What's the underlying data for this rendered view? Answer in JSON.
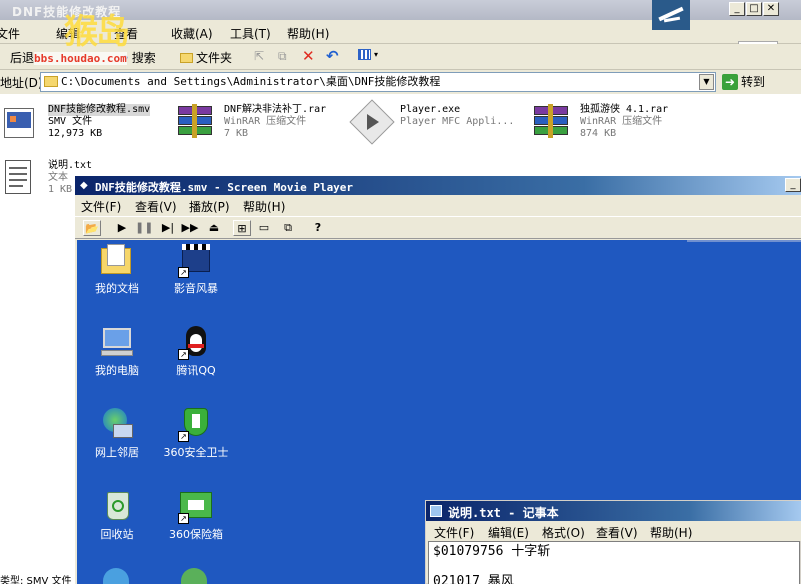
{
  "explorer": {
    "title": "DNF技能修改教程",
    "menu": [
      "文件",
      "编辑",
      "查看",
      "收藏(A)",
      "工具(T)",
      "帮助(H)"
    ],
    "toolbar": {
      "back": "后退",
      "search": "搜索",
      "folders": "文件夹"
    },
    "address": {
      "label": "地址(D)",
      "path": "C:\\Documents and Settings\\Administrator\\桌面\\DNF技能修改教程",
      "go": "转到"
    },
    "files": [
      {
        "name": "DNF技能修改教程.smv",
        "line2": "SMV 文件",
        "line3": "12,973 KB"
      },
      {
        "name": "DNF解决非法补丁.rar",
        "line2": "WinRAR 压缩文件",
        "line3": "7 KB"
      },
      {
        "name": "Player.exe",
        "line2": "Player MFC Appli..."
      },
      {
        "name": "独孤游侠 4.1.rar",
        "line2": "WinRAR 压缩文件",
        "line3": "874 KB"
      },
      {
        "name": "说明.txt",
        "line2": "文本",
        "line3": "1 KB"
      }
    ],
    "status_text": "类型: SMV 文件"
  },
  "watermark": {
    "url": "bbs.houdao.com",
    "logo_text": "猴岛"
  },
  "player": {
    "title": "DNF技能修改教程.smv - Screen Movie Player",
    "menu": [
      "文件(F)",
      "查看(V)",
      "播放(P)",
      "帮助(H)"
    ],
    "desktop_icons": [
      {
        "label": "我的文档",
        "icon": "my-documents-icon"
      },
      {
        "label": "影音风暴",
        "icon": "media-player-icon"
      },
      {
        "label": "我的电脑",
        "icon": "my-computer-icon"
      },
      {
        "label": "腾讯QQ",
        "icon": "qq-penguin-icon"
      },
      {
        "label": "网上邻居",
        "icon": "network-places-icon"
      },
      {
        "label": "360安全卫士",
        "icon": "360-safe-icon"
      },
      {
        "label": "回收站",
        "icon": "recycle-bin-icon"
      },
      {
        "label": "360保险箱",
        "icon": "360-safebox-icon"
      }
    ],
    "colors": {
      "desktop_bg": "#1f58c0",
      "title_bar": "#0a246a"
    }
  },
  "notepad": {
    "title": "说明.txt - 记事本",
    "menu": [
      "文件(F)",
      "编辑(E)",
      "格式(O)",
      "查看(V)",
      "帮助(H)"
    ],
    "lines": [
      "$01079756  十字斩",
      "021017 暴风"
    ]
  }
}
